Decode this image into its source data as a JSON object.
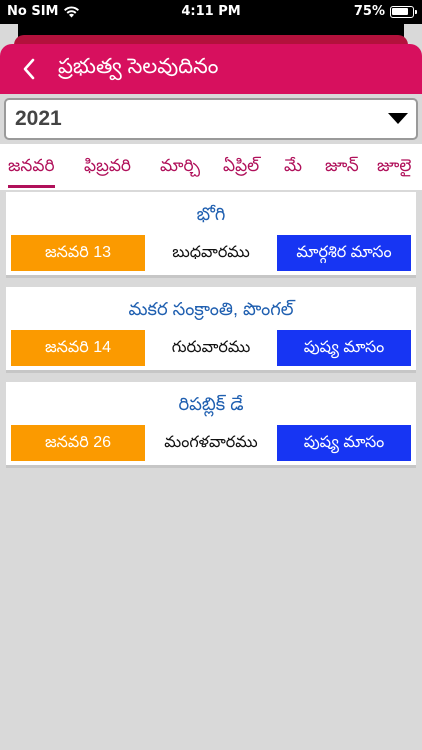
{
  "status": {
    "carrier": "No SIM",
    "time": "4:11 PM",
    "battery": "75%"
  },
  "header": {
    "title": "ప్రభుత్వ సెలవుదినం",
    "back_icon": "chevron-left-icon"
  },
  "year_select": {
    "value": "2021"
  },
  "tabs": [
    {
      "label": "జనవరి",
      "active": true
    },
    {
      "label": "ఫిబ్రవరి",
      "active": false
    },
    {
      "label": "మార్చి",
      "active": false
    },
    {
      "label": "ఏప్రిల్",
      "active": false
    },
    {
      "label": "మే",
      "active": false
    },
    {
      "label": "జూన్",
      "active": false
    },
    {
      "label": "జూలై",
      "active": false
    }
  ],
  "holidays": [
    {
      "name": "భోగి",
      "date": "జనవరి 13",
      "weekday": "బుధవారము",
      "month": "మార్గశిర మాసం"
    },
    {
      "name": "మకర సంక్రాంతి, పొంగల్",
      "date": "జనవరి 14",
      "weekday": "గురువారము",
      "month": "పుష్య మాసం"
    },
    {
      "name": "రిపబ్లిక్ డే",
      "date": "జనవరి 26",
      "weekday": "మంగళవారము",
      "month": "పుష్య మాసం"
    }
  ],
  "colors": {
    "header": "#d7105e",
    "tab_active": "#b0105a",
    "date_box": "#fb9a00",
    "month_box": "#1735f3",
    "holiday_title": "#1f5fb0"
  }
}
